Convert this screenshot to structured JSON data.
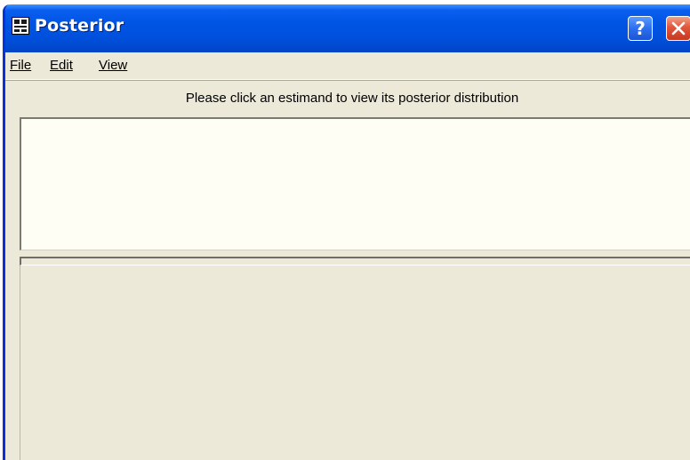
{
  "window": {
    "title": "Posterior",
    "help_label": "?"
  },
  "menu": {
    "items": [
      {
        "label": "File"
      },
      {
        "label": "Edit"
      },
      {
        "label": "View"
      }
    ]
  },
  "main": {
    "header": "Please click an estimand to view its posterior distribution"
  },
  "icons": [
    "window-app-icon",
    "help-icon",
    "close-icon"
  ],
  "colors": {
    "titlebar": "#0054E3",
    "window_bg": "#ECE9D8",
    "list_bg": "#FEFEF5",
    "close_button": "#E1553A"
  }
}
